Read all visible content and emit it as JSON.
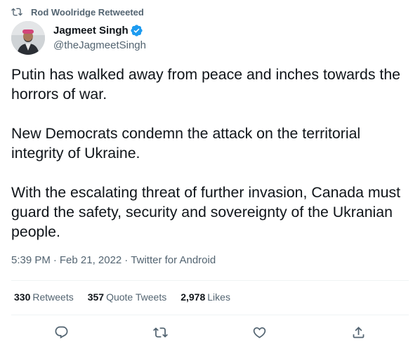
{
  "retweet_header": {
    "text": "Rod Woolridge Retweeted",
    "icon": "retweet-icon"
  },
  "author": {
    "display_name": "Jagmeet Singh",
    "handle": "@theJagmeetSingh",
    "verified": true,
    "verified_color": "#1d9bf0"
  },
  "tweet": {
    "paragraphs": [
      "Putin has walked away from peace and inches towards the horrors of war.",
      "New Democrats condemn the attack on the territorial integrity of Ukraine.",
      "With the escalating threat of further invasion, Canada must guard the safety, security and sovereignty of the Ukranian people."
    ],
    "time": "5:39 PM",
    "date": "Feb 21, 2022",
    "source": "Twitter for Android",
    "separator": "·"
  },
  "stats": {
    "retweets": {
      "count": "330",
      "label": "Retweets"
    },
    "quote_tweets": {
      "count": "357",
      "label": "Quote Tweets"
    },
    "likes": {
      "count": "2,978",
      "label": "Likes"
    }
  },
  "actions": [
    "reply-icon",
    "retweet-icon",
    "like-icon",
    "share-icon"
  ],
  "colors": {
    "text": "#0f1419",
    "secondary": "#536471",
    "divider": "#eff3f4"
  }
}
